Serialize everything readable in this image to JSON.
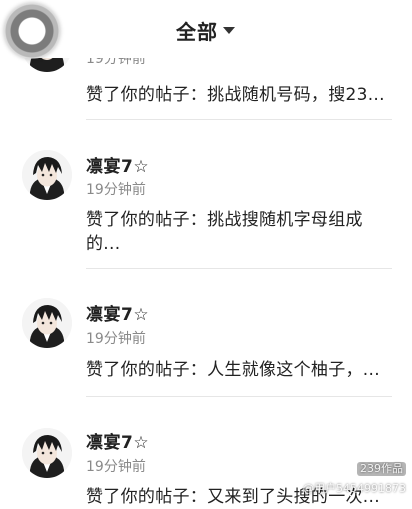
{
  "header": {
    "title": "全部",
    "dropdown_icon": "caret-down-icon"
  },
  "float_button": {
    "icon": "ring-icon"
  },
  "notifications": [
    {
      "user": "",
      "time": "19分钟前",
      "text": "赞了你的帖子：挑战随机号码，搜23..."
    },
    {
      "user": "凛宴7☆",
      "time": "19分钟前",
      "text": "赞了你的帖子：挑战搜随机字母组成的..."
    },
    {
      "user": "凛宴7☆",
      "time": "19分钟前",
      "text": "赞了你的帖子：人生就像这个柚子，..."
    },
    {
      "user": "凛宴7☆",
      "time": "19分钟前",
      "text": "赞了你的帖子：又来到了头搜的一次..."
    }
  ],
  "watermark": {
    "badge": "239作品",
    "handle": "@用户5454991873"
  }
}
